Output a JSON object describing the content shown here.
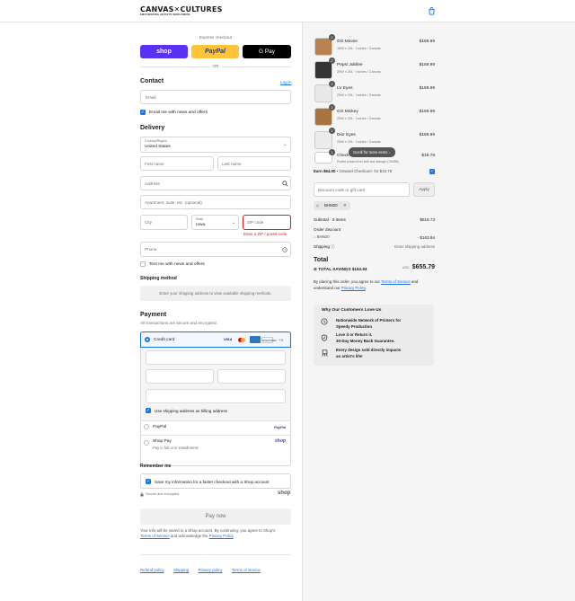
{
  "header": {
    "logo": "CANVAS✕CULTURES",
    "logo_sub": "EMPOWERING ARTISTS WORLDWIDE"
  },
  "express": {
    "title": "Express checkout",
    "shop_label": "shop",
    "paypal_label": "PayPal",
    "gpay_label": "G Pay",
    "or_label": "OR"
  },
  "contact": {
    "title": "Contact",
    "login_label": "Log in",
    "email_placeholder": "Email",
    "email_news_label": "Email me with news and offers"
  },
  "delivery": {
    "title": "Delivery",
    "country_label": "Country/Region",
    "country_value": "United States",
    "first_name_ph": "First name",
    "last_name_ph": "Last name",
    "address_ph": "Address",
    "apartment_ph": "Apartment, suite, etc. (optional)",
    "city_ph": "City",
    "state_label": "State",
    "state_value": "Iowa",
    "zip_ph": "ZIP code",
    "zip_error": "Enter a ZIP / postal code",
    "phone_ph": "Phone",
    "text_news_label": "Text me with news and offers"
  },
  "shipping_method": {
    "title": "Shipping method",
    "notice": "Enter your shipping address to view available shipping methods."
  },
  "payment": {
    "title": "Payment",
    "subtitle": "All transactions are secure and encrypted.",
    "credit_card_label": "Credit card",
    "card_more": "+4",
    "billing_same_label": "Use shipping address as billing address",
    "paypal_label": "PayPal",
    "paypal_logo": "PayPal",
    "shoppay_label": "Shop Pay",
    "shoppay_sub": "Pay in full or in installments",
    "shoppay_logo": "shop"
  },
  "remember": {
    "title": "Remember me",
    "save_label": "Save my information for a faster checkout with a Shop account",
    "secure_label": "Secure and encrypted",
    "shop_logo": "shop"
  },
  "pay_now_label": "Pay now",
  "legal": {
    "line1": "Your info will be saved to a Shop account. By continuing, you agree to Shop's",
    "terms": "Terms of Service",
    "and_ack": " and acknowledge the ",
    "privacy": "Privacy Policy",
    "dot": "."
  },
  "footer": {
    "links": [
      "Refund policy",
      "Shipping",
      "Privacy policy",
      "Terms of service"
    ]
  },
  "cart": {
    "items": [
      {
        "qty": "2",
        "name": "GG Minnie",
        "variant": "16W x 24L · Inches / Canvas",
        "price": "$159.99"
      },
      {
        "qty": "2",
        "name": "Pepsi Jubilee",
        "variant": "20W x 20L · Inches / Canvas",
        "price": "$159.99"
      },
      {
        "qty": "2",
        "name": "LV Eyes",
        "variant": "20W x 20L · Inches / Canvas",
        "price": "$159.99"
      },
      {
        "qty": "2",
        "name": "GG Mickey",
        "variant": "20W x 20L · Inches / Canvas",
        "price": "$159.99"
      },
      {
        "qty": "2",
        "name": "Dior Eyes",
        "variant": "20W x 20L · Inches / Canvas",
        "price": "$159.99"
      }
    ],
    "checkout_item_name": "Check",
    "checkout_item_sub": "Protect product from theft and damage (CHUBB)",
    "checkout_item_price": "$19.78",
    "scroll_tooltip": "Scroll for more items ↓",
    "earn_bold": "Earn $64.00",
    "earn_rest": " • Onward Checkout+ for $19.78",
    "discount_ph": "Discount code or gift card",
    "apply_label": "Apply",
    "tag_label": "BHM20",
    "subtotal_label": "Subtotal · 6 items",
    "subtotal_value": "$819.73",
    "order_discount_label": "Order discount",
    "discount_code": "BHM20",
    "discount_value": "- $163.94",
    "shipping_label": "Shipping",
    "shipping_value": "Enter shipping address",
    "total_label": "Total",
    "currency": "USD",
    "total_value": "$655.79",
    "savings_label": "TOTAL SAVINGS",
    "savings_value": "$163.94",
    "agree_text": "By placing this order, you agree to our ",
    "agree_terms": "Terms of Service",
    "agree_and": " and understand our ",
    "agree_privacy": "Privacy Policy",
    "agree_dot": "."
  },
  "love": {
    "title": "Why Our Customers Love Us",
    "items": [
      {
        "line1": "Nationwide Network of Printers for",
        "line2": "Speedy Production"
      },
      {
        "line1": "Love it or Return it.",
        "line2": "30-Day Money Back Guarantee."
      },
      {
        "line1": "Every design sold directly impacts",
        "line2": "an artist's life!"
      }
    ]
  }
}
